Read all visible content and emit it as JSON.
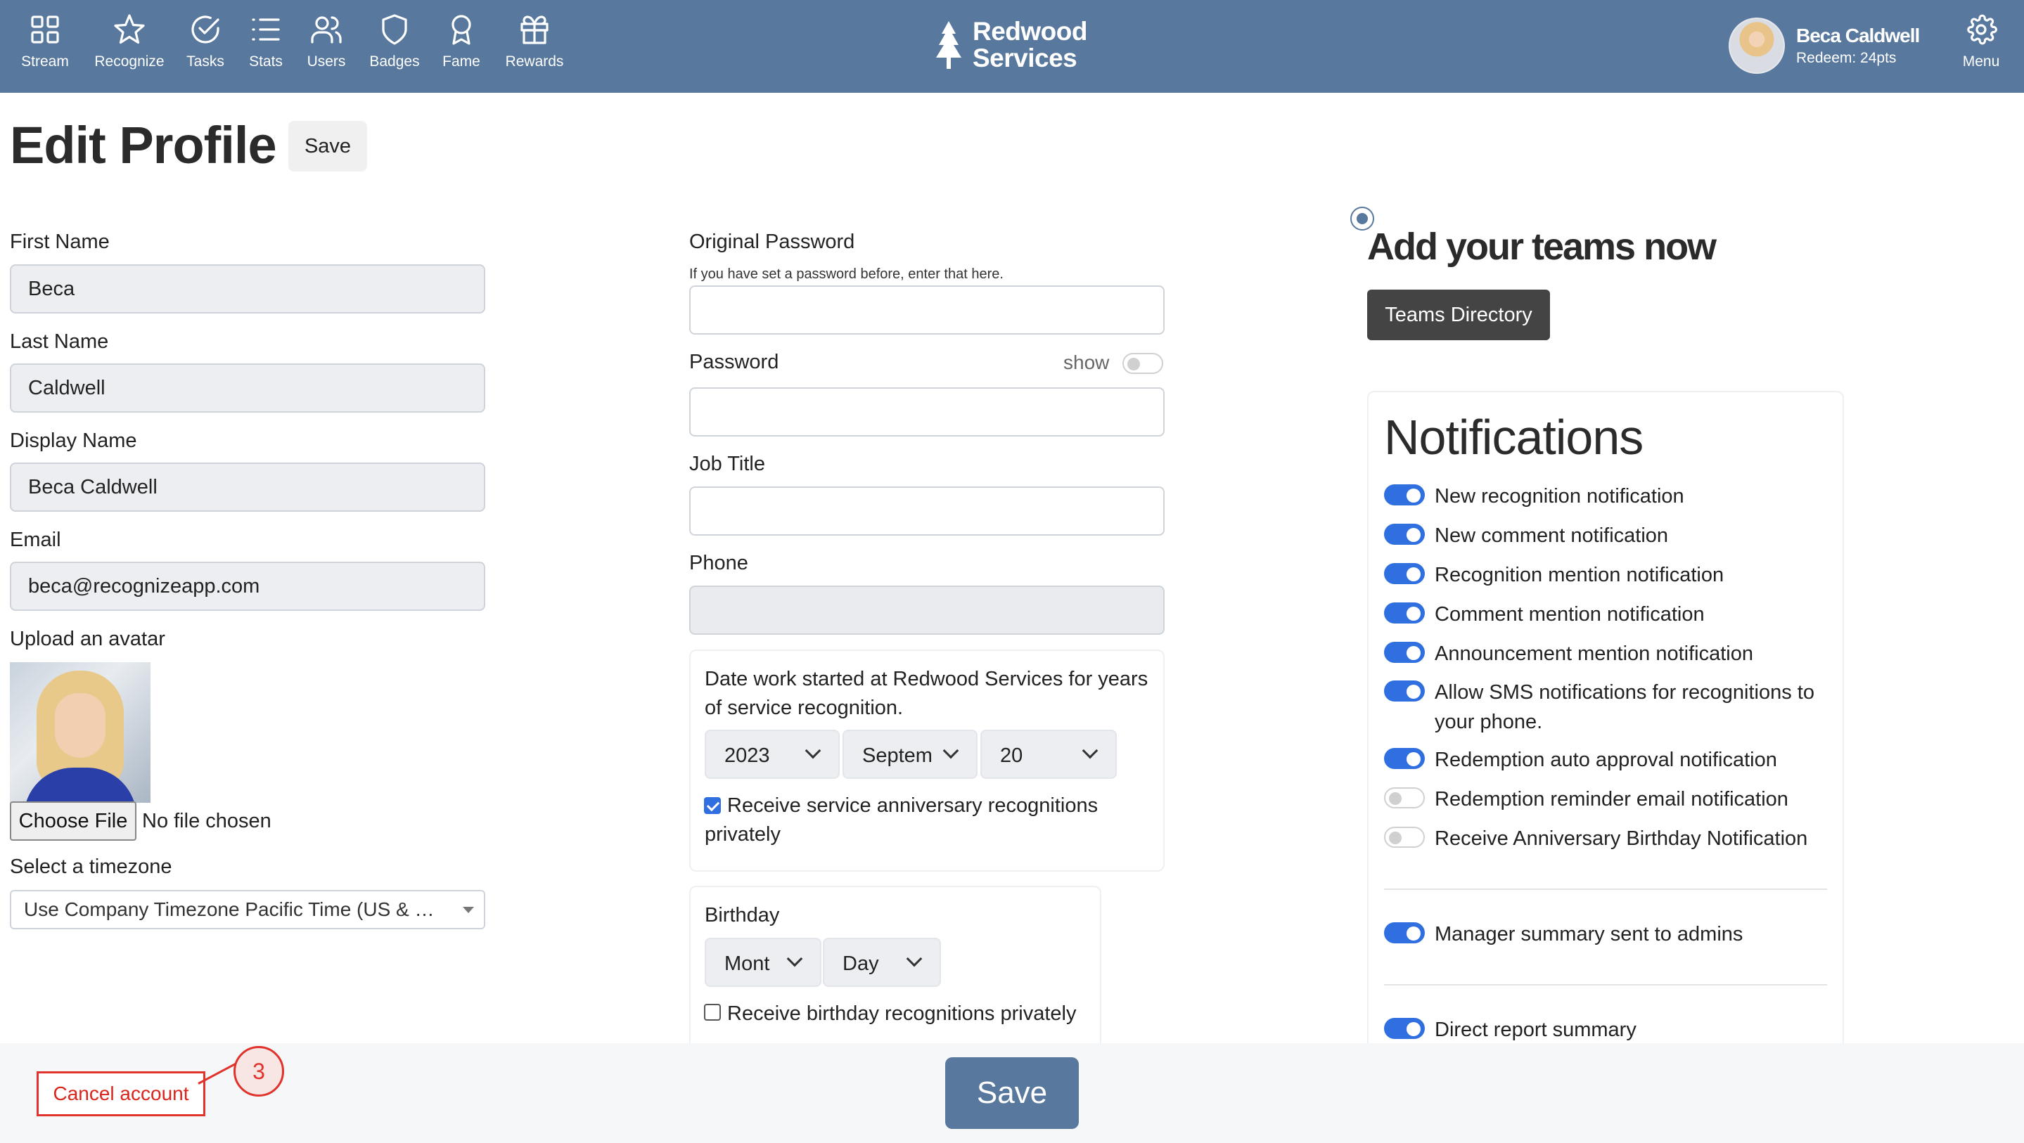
{
  "nav": {
    "items": [
      {
        "label": "Stream",
        "icon": "grid-icon"
      },
      {
        "label": "Recognize",
        "icon": "star-icon"
      },
      {
        "label": "Tasks",
        "icon": "check-circle-icon"
      },
      {
        "label": "Stats",
        "icon": "list-icon"
      },
      {
        "label": "Users",
        "icon": "users-icon"
      },
      {
        "label": "Badges",
        "icon": "shield-icon"
      },
      {
        "label": "Fame",
        "icon": "award-icon"
      },
      {
        "label": "Rewards",
        "icon": "gift-icon"
      }
    ],
    "brand_line1": "Redwood",
    "brand_line2": "Services",
    "user_name": "Beca Caldwell",
    "user_points": "Redeem: 24pts",
    "menu_label": "Menu",
    "bar_color": "#58789d"
  },
  "header": {
    "title": "Edit Profile",
    "save_label": "Save"
  },
  "profile": {
    "first_name_label": "First Name",
    "first_name": "Beca",
    "last_name_label": "Last Name",
    "last_name": "Caldwell",
    "display_name_label": "Display Name",
    "display_name": "Beca Caldwell",
    "email_label": "Email",
    "email": "beca@recognizeapp.com",
    "avatar_label": "Upload an avatar",
    "choose_file": "Choose File",
    "no_file": "No file chosen",
    "timezone_label": "Select a timezone",
    "timezone_value": "Use Company Timezone Pacific Time (US & Can..."
  },
  "security": {
    "original_password_label": "Original Password",
    "original_password_hint": "If you have set a password before, enter that here.",
    "password_label": "Password",
    "show_label": "show",
    "job_title_label": "Job Title",
    "phone_label": "Phone"
  },
  "service": {
    "text": "Date work started at Redwood Services for years of service recognition.",
    "year": "2023",
    "month": "Septem",
    "day": "20",
    "private_label": "Receive service anniversary recognitions privately",
    "private_checked": true
  },
  "birthday": {
    "label": "Birthday",
    "month": "Mont",
    "day": "Day",
    "private_label": "Receive birthday recognitions privately",
    "private_checked": false
  },
  "teams": {
    "title": "Add your teams now",
    "button": "Teams Directory"
  },
  "notifications": {
    "title": "Notifications",
    "items": [
      {
        "label": "New recognition notification",
        "on": true
      },
      {
        "label": "New comment notification",
        "on": true
      },
      {
        "label": "Recognition mention notification",
        "on": true
      },
      {
        "label": "Comment mention notification",
        "on": true
      },
      {
        "label": "Announcement mention notification",
        "on": true
      },
      {
        "label": "Allow SMS notifications for recognitions to your phone.",
        "on": true
      },
      {
        "label": "Redemption auto approval notification",
        "on": true
      },
      {
        "label": "Redemption reminder email notification",
        "on": false
      },
      {
        "label": "Receive Anniversary Birthday Notification",
        "on": false
      }
    ],
    "manager_summary": {
      "label": "Manager summary sent to admins",
      "on": true
    },
    "direct_report": {
      "label": "Direct report summary",
      "on": true
    }
  },
  "footer": {
    "cancel_label": "Cancel account",
    "annotation_number": "3",
    "save_label": "Save"
  }
}
